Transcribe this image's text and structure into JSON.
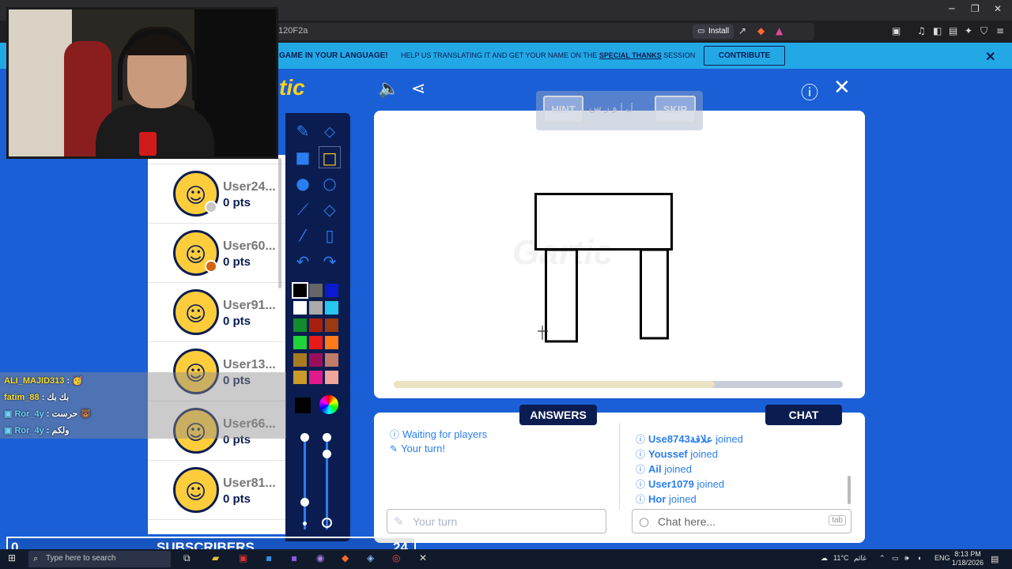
{
  "browser": {
    "url_fragment": "120F2a",
    "install_label": "Install",
    "window_controls": [
      "─",
      "❐",
      "✕"
    ]
  },
  "banner": {
    "bold_text": "GAME IN YOUR LANGUAGE!",
    "text_before": "HELP US TRANSLATING IT AND GET YOUR NAME ON THE ",
    "text_link": "SPECIAL THANKS",
    "text_after": " SESSION",
    "contribute_label": "CONTRIBUTE",
    "close_glyph": "✕"
  },
  "game": {
    "logo_text": "tic",
    "hint_label": "HINT",
    "skip_label": "SKIP",
    "hint_letters": "ل ا و ر س",
    "watermark": "Gartic",
    "progress_fraction": 0.715
  },
  "players": [
    {
      "name": "User24...",
      "points": "0 pts",
      "status_color": "#c8c8c8"
    },
    {
      "name": "User60...",
      "points": "0 pts",
      "status_color": "#d4640f"
    },
    {
      "name": "User91...",
      "points": "0 pts",
      "status_color": ""
    },
    {
      "name": "User13...",
      "points": "0 pts",
      "status_color": ""
    },
    {
      "name": "User66...",
      "points": "0 pts",
      "status_color": ""
    },
    {
      "name": "User81...",
      "points": "0 pts",
      "status_color": ""
    }
  ],
  "tools": {
    "palette": [
      "#000000",
      "#666666",
      "#0a1acf",
      "#ffffff",
      "#aaaaaa",
      "#27c6f0",
      "#138a2e",
      "#a8200d",
      "#9a3a12",
      "#20d33b",
      "#ea1a1a",
      "#ff7a1a",
      "#a87a22",
      "#9a0f5a",
      "#c27a6a",
      "#ca9a2a",
      "#e01a8a",
      "#f0a59a"
    ],
    "selected_color": "#000000"
  },
  "answers": {
    "tab_label": "ANSWERS",
    "messages": [
      "Waiting for players",
      "Your turn!"
    ],
    "input_placeholder": "Your turn"
  },
  "chat": {
    "tab_label": "CHAT",
    "messages": [
      {
        "user": "Useعلاقة8743",
        "text": " joined"
      },
      {
        "user": "Youssef",
        "text": " joined"
      },
      {
        "user": "Ail",
        "text": " joined"
      },
      {
        "user": "User1079",
        "text": " joined"
      },
      {
        "user": "Hor",
        "text": " joined"
      }
    ],
    "input_placeholder": "Chat here...",
    "tab_key": "tab"
  },
  "stream_chat": [
    {
      "user": "ALI_MAJID313",
      "text": " : 🥳"
    },
    {
      "user": "fatim_88",
      "text": " : بك بك"
    },
    {
      "user": "Ror_4y",
      "text": " : حرست 🐻"
    },
    {
      "user": "Ror_4y",
      "text": " : ولكم"
    }
  ],
  "subscribers": {
    "left_count": "0",
    "label": "SUBSCRIBERS",
    "right_count": "24"
  },
  "taskbar": {
    "search_placeholder": "Type here to search",
    "weather": "11°C",
    "weather_text": "غائم",
    "language": "ENG",
    "time": "8:13 PM",
    "date": "1/18/2026"
  }
}
